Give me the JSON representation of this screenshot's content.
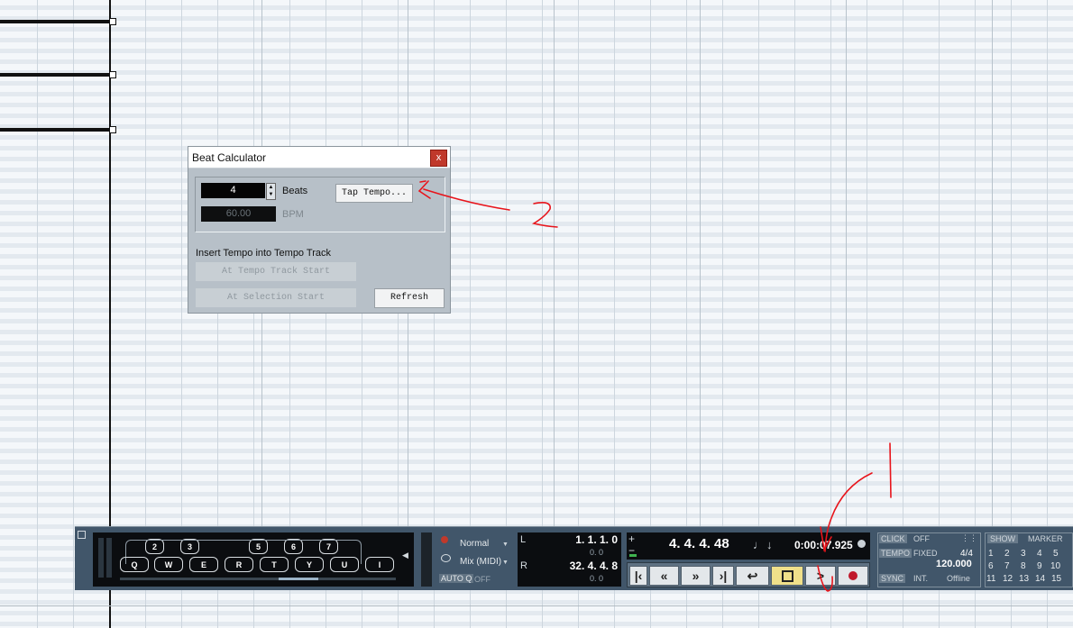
{
  "beat_calculator": {
    "title": "Beat Calculator",
    "close_label": "x",
    "beats_value": "4",
    "beats_label": "Beats",
    "tap_tempo_label": "Tap Tempo...",
    "bpm_value": "60.00",
    "bpm_label": "BPM",
    "insert_heading": "Insert Tempo into Tempo Track",
    "at_tempo_track_start": "At Tempo Track Start",
    "at_selection_start": "At Selection Start",
    "refresh_label": "Refresh"
  },
  "transport": {
    "corner_icon": "window-icon",
    "keys_top": [
      "2",
      "3",
      "5",
      "6",
      "7"
    ],
    "keys_bottom": [
      "Q",
      "W",
      "E",
      "R",
      "T",
      "Y",
      "U",
      "I"
    ],
    "record_mode": "Normal",
    "cycle_mode": "Mix (MIDI)",
    "auto_q_label": "AUTO Q",
    "auto_q_value": "OFF",
    "left_locator": "1.  1.  1.    0",
    "left_offset": "0.    0",
    "right_locator": "32.  4.  4.    8",
    "right_offset": "0.    0",
    "left_letter": "L",
    "right_letter": "R",
    "position_bars": "4.  4.  4.  48",
    "position_time": "0:00:07.925",
    "click_label": "CLICK",
    "click_value": "OFF",
    "tempo_label": "TEMPO",
    "tempo_mode": "FIXED",
    "signature": "4/4",
    "tempo_value": "120.000",
    "sync_label": "SYNC",
    "sync_mode": "INT.",
    "sync_status": "Offline",
    "show_label": "SHOW",
    "marker_label": "MARKER",
    "marker_row1": [
      "1",
      "2",
      "3",
      "4",
      "5"
    ],
    "marker_row2": [
      "6",
      "7",
      "8",
      "9",
      "10"
    ],
    "marker_row3": [
      "11",
      "12",
      "13",
      "14",
      "15"
    ]
  },
  "annotations": {
    "label_1": "1",
    "label_2": "2",
    "color": "#e8141b"
  }
}
